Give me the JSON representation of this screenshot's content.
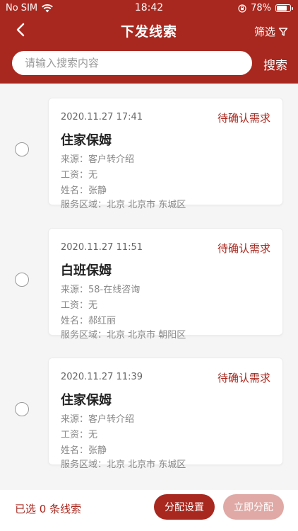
{
  "status_bar": {
    "carrier": "No SIM",
    "time": "18:42",
    "battery": "78%"
  },
  "nav": {
    "title": "下发线索",
    "filter_label": "筛选"
  },
  "search": {
    "placeholder": "请输入搜索内容",
    "button_label": "搜索"
  },
  "leads": [
    {
      "date": "2020.11.27 17:41",
      "status": "待确认需求",
      "title": "住家保姆",
      "source": "来源：客户转介绍",
      "salary": "工资：无",
      "name": "姓名：张静",
      "area": "服务区域：北京 北京市 东城区"
    },
    {
      "date": "2020.11.27 11:51",
      "status": "待确认需求",
      "title": "白班保姆",
      "source": "来源：58-在线咨询",
      "salary": "工资：无",
      "name": "姓名：郝红丽",
      "area": "服务区域：北京 北京市 朝阳区"
    },
    {
      "date": "2020.11.27 11:39",
      "status": "待确认需求",
      "title": "住家保姆",
      "source": "来源：客户转介绍",
      "salary": "工资：无",
      "name": "姓名：张静",
      "area": "服务区域：北京 北京市 东城区"
    }
  ],
  "footer": {
    "selected_text": "已选 0 条线索",
    "assign_settings": "分配设置",
    "assign_now": "立即分配"
  },
  "colors": {
    "brand": "#a8281f",
    "disabled": "#e0a9a5"
  },
  "icons": [
    "back-arrow-icon",
    "filter-icon",
    "wifi-icon",
    "lock-rotation-icon",
    "battery-icon"
  ]
}
